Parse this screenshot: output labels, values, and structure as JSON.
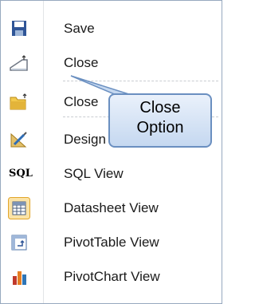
{
  "menu": {
    "items": [
      {
        "label": "Save",
        "icon": "save-icon"
      },
      {
        "label": "Close",
        "icon": "close-icon"
      },
      {
        "label": "Close",
        "icon": "close-all-icon"
      },
      {
        "label": "Design View",
        "icon": "design-view-icon"
      },
      {
        "label": "SQL View",
        "icon": "sql-icon"
      },
      {
        "label": "Datasheet View",
        "icon": "datasheet-icon"
      },
      {
        "label": "PivotTable View",
        "icon": "pivottable-icon"
      },
      {
        "label": "PivotChart View",
        "icon": "pivotchart-icon"
      }
    ],
    "sql_icon_text": "SQL"
  },
  "callout": {
    "text": "Close Option",
    "line1": "Close",
    "line2": "Option",
    "fill_top": "#eaf1fb",
    "fill_bottom": "#c5d8f0",
    "border_color": "#6a8fc0"
  },
  "colors": {
    "menu_border": "#97a9bf",
    "text": "#1a1a1a"
  }
}
